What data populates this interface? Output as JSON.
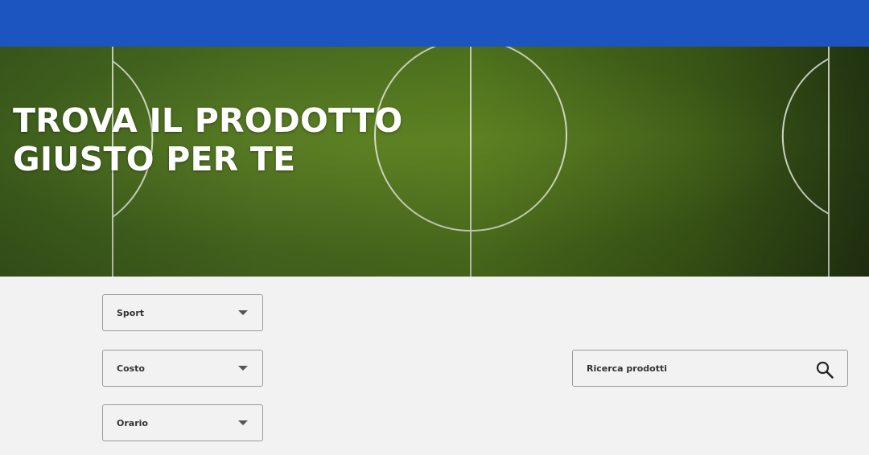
{
  "hero": {
    "title_line1": "TROVA IL PRODOTTO",
    "title_line2": "GIUSTO PER TE",
    "background": "football-pitch-image"
  },
  "filters": [
    {
      "label": "Sport",
      "icon": "chevron-down-icon"
    },
    {
      "label": "Costo",
      "icon": "chevron-down-icon"
    },
    {
      "label": "Orario",
      "icon": "chevron-down-icon"
    }
  ],
  "search": {
    "placeholder": "Ricerca prodotti",
    "value": "",
    "icon": "search-icon"
  },
  "colors": {
    "topbar": "#1c54c0",
    "page_background": "#f2f2f2",
    "pitch_green": "#4d7222"
  }
}
